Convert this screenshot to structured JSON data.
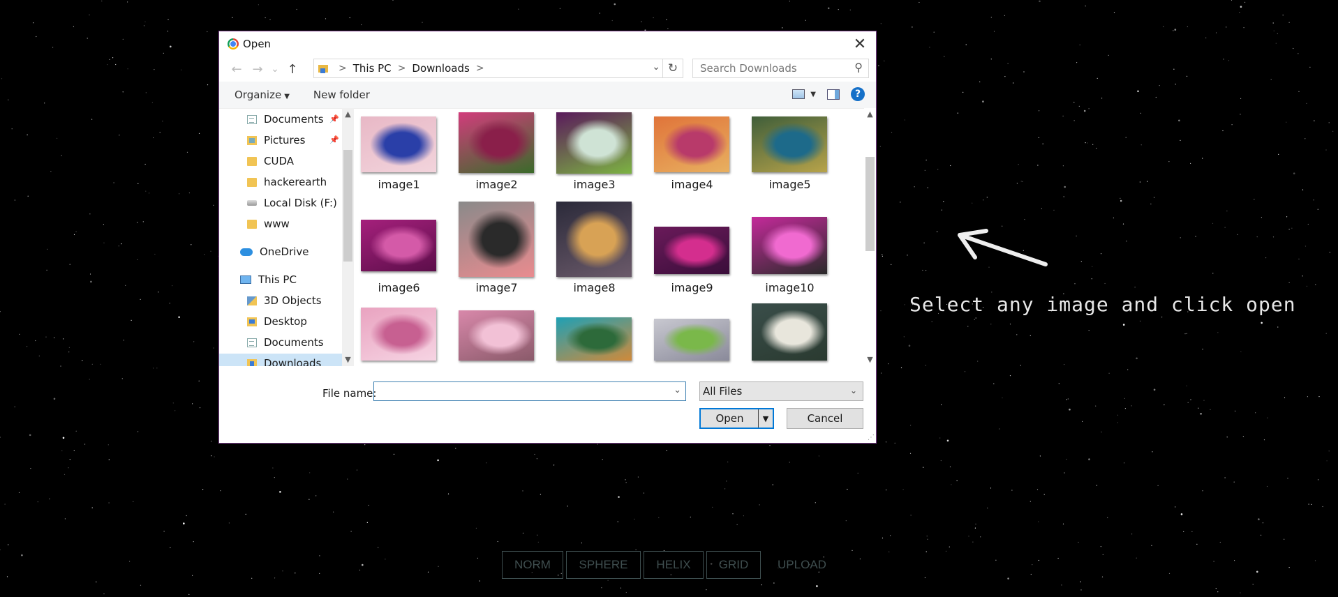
{
  "background": {
    "color": "#000000",
    "star_color": "#ffffff"
  },
  "hint_text": "Select any image and click open",
  "modes": [
    "NORM",
    "SPHERE",
    "HELIX",
    "GRID",
    "UPLOAD"
  ],
  "dialog": {
    "title": "Open",
    "app_icon": "chrome-icon",
    "close_glyph": "✕",
    "nav": {
      "back": "←",
      "forward": "→",
      "recent": "⌄",
      "up": "↑",
      "refresh": "↻"
    },
    "breadcrumb": [
      "This PC",
      "Downloads"
    ],
    "breadcrumb_sep": ">",
    "search_placeholder": "Search Downloads",
    "toolbar": {
      "organize": "Organize",
      "new_folder": "New folder",
      "help": "?"
    },
    "sidebar": [
      {
        "label": "Documents",
        "icon": "documents-icon",
        "pinned": true
      },
      {
        "label": "Pictures",
        "icon": "pictures-icon",
        "pinned": true
      },
      {
        "label": "CUDA",
        "icon": "folder-icon"
      },
      {
        "label": "hackerearth",
        "icon": "folder-icon"
      },
      {
        "label": "Local Disk (F:)",
        "icon": "drive-icon"
      },
      {
        "label": "www",
        "icon": "folder-icon"
      },
      {
        "label": "OneDrive",
        "icon": "onedrive-icon"
      },
      {
        "label": "This PC",
        "icon": "computer-icon"
      },
      {
        "label": "3D Objects",
        "icon": "3d-objects-icon"
      },
      {
        "label": "Desktop",
        "icon": "desktop-icon"
      },
      {
        "label": "Documents",
        "icon": "documents-icon"
      },
      {
        "label": "Downloads",
        "icon": "downloads-icon",
        "selected": true
      }
    ],
    "files": [
      {
        "name": "image1",
        "colors": [
          "#e8b8c6",
          "#2a3fa8",
          "#f2d4dc"
        ]
      },
      {
        "name": "image2",
        "colors": [
          "#d23c7c",
          "#8a1f4a",
          "#3a6b2a"
        ]
      },
      {
        "name": "image3",
        "colors": [
          "#5a1a5c",
          "#cfe3d5",
          "#7cb342"
        ]
      },
      {
        "name": "image4",
        "colors": [
          "#e0743a",
          "#b83a6a",
          "#e8b060"
        ]
      },
      {
        "name": "image5",
        "colors": [
          "#3f5e3a",
          "#1d6a8a",
          "#b7a34a"
        ]
      },
      {
        "name": "image6",
        "colors": [
          "#a5207c",
          "#d45aa8",
          "#5c0e4a"
        ]
      },
      {
        "name": "image7",
        "colors": [
          "#8a8a8a",
          "#2a2a2a",
          "#e98b8f"
        ]
      },
      {
        "name": "image8",
        "colors": [
          "#2b2a3a",
          "#d8a255",
          "#6b5a6a"
        ]
      },
      {
        "name": "image9",
        "colors": [
          "#6a1a5a",
          "#d42e8e",
          "#3a0e3a"
        ]
      },
      {
        "name": "image10",
        "colors": [
          "#c42a9a",
          "#f06ad0",
          "#2a2a2a"
        ]
      },
      {
        "name": "",
        "colors": [
          "#e9a3c0",
          "#c76091",
          "#f6d4e3"
        ]
      },
      {
        "name": "",
        "colors": [
          "#d888aa",
          "#f2c1d6",
          "#8a5a6a"
        ]
      },
      {
        "name": "",
        "colors": [
          "#1fa0b5",
          "#2d6a3a",
          "#d08a3a"
        ]
      },
      {
        "name": "",
        "colors": [
          "#c8c8d0",
          "#7ab84a",
          "#8a8a9a"
        ]
      },
      {
        "name": "",
        "colors": [
          "#3a4e4a",
          "#e8e6dc",
          "#2a3a30"
        ]
      }
    ],
    "file_name_label": "File name:",
    "file_name_value": "",
    "file_type": "All Files",
    "open_button": "Open",
    "cancel_button": "Cancel",
    "accent": "#0078d7"
  }
}
